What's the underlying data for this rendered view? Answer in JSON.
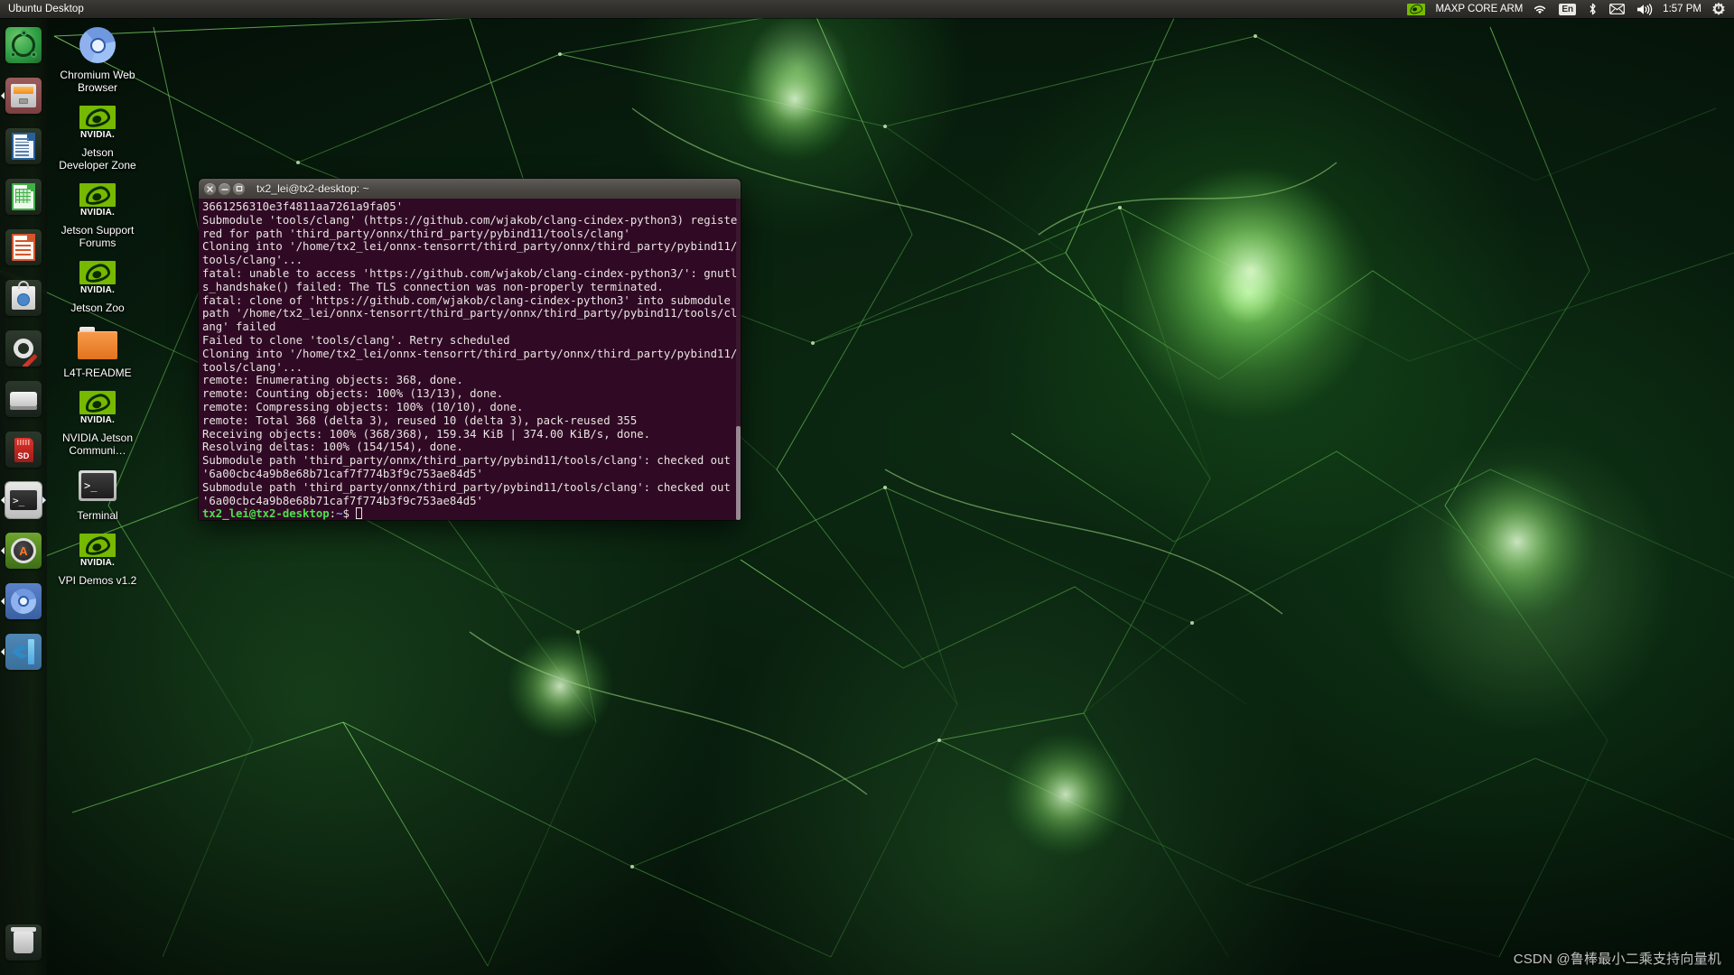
{
  "top_panel": {
    "title": "Ubuntu Desktop",
    "indicators": {
      "nvidia_icon": "nvidia-eye-icon",
      "session_label": "MAXP CORE ARM",
      "wifi_icon": "wifi-icon",
      "keyboard_layout": "En",
      "bluetooth_icon": "bluetooth-icon",
      "mail_icon": "envelope-icon",
      "volume_icon": "speaker-icon",
      "clock": "1:57 PM",
      "session_menu_icon": "power-gear-icon"
    }
  },
  "launcher": {
    "items": [
      {
        "name": "dash-home",
        "icon": "ubuntu-logo-icon",
        "label": "Ubuntu Dash",
        "running": false,
        "focused": false
      },
      {
        "name": "files",
        "icon": "file-cabinet-icon",
        "label": "Files",
        "running": true,
        "focused": false
      },
      {
        "name": "libreoffice-writer",
        "icon": "document-icon",
        "label": "LibreOffice Writer",
        "running": false,
        "focused": false
      },
      {
        "name": "libreoffice-calc",
        "icon": "spreadsheet-icon",
        "label": "LibreOffice Calc",
        "running": false,
        "focused": false
      },
      {
        "name": "libreoffice-impress",
        "icon": "presentation-icon",
        "label": "LibreOffice Impress",
        "running": false,
        "focused": false
      },
      {
        "name": "ubuntu-software",
        "icon": "shopping-bag-icon",
        "label": "Ubuntu Software",
        "running": false,
        "focused": false
      },
      {
        "name": "system-settings",
        "icon": "gear-wrench-icon",
        "label": "System Settings",
        "running": false,
        "focused": false
      },
      {
        "name": "disk-drive",
        "icon": "hard-drive-icon",
        "label": "Disk",
        "running": false,
        "focused": false
      },
      {
        "name": "sd-card",
        "icon": "sd-card-icon",
        "label": "SD Card",
        "running": false,
        "focused": false
      },
      {
        "name": "terminal",
        "icon": "terminal-icon",
        "label": "Terminal",
        "running": true,
        "focused": true
      },
      {
        "name": "software-updater",
        "icon": "updater-icon",
        "label": "Software Updater",
        "running": true,
        "focused": false
      },
      {
        "name": "chromium",
        "icon": "chromium-icon",
        "label": "Chromium Web Browser",
        "running": true,
        "focused": false
      },
      {
        "name": "vscode",
        "icon": "vscode-icon",
        "label": "Visual Studio Code",
        "running": true,
        "focused": false
      }
    ],
    "trash": {
      "name": "trash",
      "icon": "trash-icon",
      "label": "Trash"
    }
  },
  "desktop_icons": [
    {
      "name": "chromium-web-browser",
      "icon": "chromium-icon",
      "label": "Chromium Web Browser"
    },
    {
      "name": "jetson-developer-zone",
      "icon": "nvidia-logo-icon",
      "label": "Jetson Developer Zone"
    },
    {
      "name": "jetson-support-forums",
      "icon": "nvidia-logo-icon",
      "label": "Jetson Support Forums"
    },
    {
      "name": "jetson-zoo",
      "icon": "nvidia-logo-icon",
      "label": "Jetson Zoo"
    },
    {
      "name": "l4t-readme",
      "icon": "folder-icon",
      "label": "L4T-README"
    },
    {
      "name": "nvidia-jetson-community",
      "icon": "nvidia-logo-icon",
      "label": "NVIDIA Jetson Communi…"
    },
    {
      "name": "terminal-shortcut",
      "icon": "terminal-icon",
      "label": "Terminal"
    },
    {
      "name": "vpi-demos",
      "icon": "nvidia-logo-icon",
      "label": "VPI Demos v1.2"
    }
  ],
  "nvidia_wordmark": "NVIDIA.",
  "terminal": {
    "title": "tx2_lei@tx2-desktop: ~",
    "buttons": {
      "close": "close-icon",
      "minimize": "minimize-icon",
      "maximize": "maximize-icon"
    },
    "lines": [
      "3661256310e3f4811aa7261a9fa05'",
      "Submodule 'tools/clang' (https://github.com/wjakob/clang-cindex-python3) registe",
      "red for path 'third_party/onnx/third_party/pybind11/tools/clang'",
      "Cloning into '/home/tx2_lei/onnx-tensorrt/third_party/onnx/third_party/pybind11/",
      "tools/clang'...",
      "fatal: unable to access 'https://github.com/wjakob/clang-cindex-python3/': gnutl",
      "s_handshake() failed: The TLS connection was non-properly terminated.",
      "fatal: clone of 'https://github.com/wjakob/clang-cindex-python3' into submodule",
      "path '/home/tx2_lei/onnx-tensorrt/third_party/onnx/third_party/pybind11/tools/cl",
      "ang' failed",
      "Failed to clone 'tools/clang'. Retry scheduled",
      "Cloning into '/home/tx2_lei/onnx-tensorrt/third_party/onnx/third_party/pybind11/",
      "tools/clang'...",
      "remote: Enumerating objects: 368, done.",
      "remote: Counting objects: 100% (13/13), done.",
      "remote: Compressing objects: 100% (10/10), done.",
      "remote: Total 368 (delta 3), reused 10 (delta 3), pack-reused 355",
      "Receiving objects: 100% (368/368), 159.34 KiB | 374.00 KiB/s, done.",
      "Resolving deltas: 100% (154/154), done.",
      "Submodule path 'third_party/onnx/third_party/pybind11/tools/clang': checked out",
      "'6a00cbc4a9b8e68b71caf7f774b3f9c753ae84d5'",
      "Submodule path 'third_party/onnx/third_party/pybind11/tools/clang': checked out",
      "'6a00cbc4a9b8e68b71caf7f774b3f9c753ae84d5'"
    ],
    "prompt": {
      "user_host": "tx2_lei@tx2-desktop",
      "separator": ":",
      "path": "~",
      "symbol": "$"
    },
    "colors": {
      "background": "#300a24",
      "foreground": "#e8e4e2",
      "prompt_user": "#4ee24e",
      "prompt_path": "#7a9ef7"
    }
  },
  "watermark": "CSDN @鲁棒最小二乘支持向量机",
  "theme": {
    "panel_bg": "#2f2e2b",
    "launcher_bg": "#101c10",
    "accent_green": "#76b900",
    "titlebar_bg": "#4c4945"
  }
}
